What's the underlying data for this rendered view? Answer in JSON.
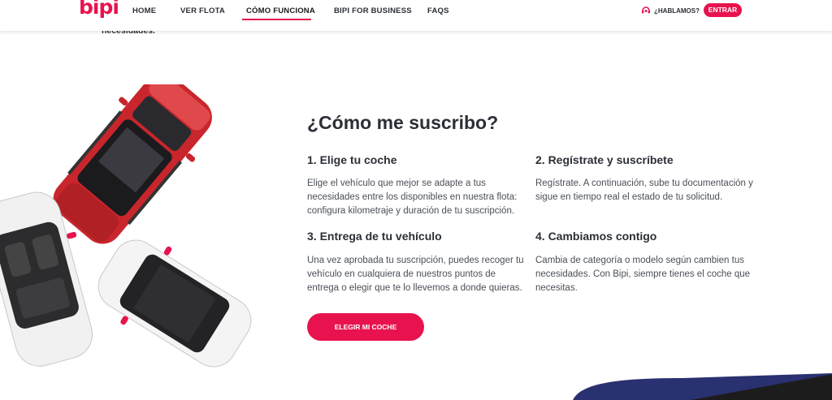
{
  "header": {
    "logo": "bipi",
    "nav": [
      {
        "label": "HOME"
      },
      {
        "label": "VER FLOTA"
      },
      {
        "label": "CÓMO FUNCIONA",
        "active": true
      },
      {
        "label": "BIPI FOR BUSINESS"
      },
      {
        "label": "FAQS"
      }
    ],
    "help_label": "¿HABLAMOS?",
    "login_label": "ENTRAR"
  },
  "previous_section_text": "necesidades.",
  "main": {
    "title": "¿Cómo me suscribo?",
    "steps": [
      {
        "title": "1. Elige tu coche",
        "text": "Elige el vehículo que mejor se adapte a tus necesidades entre los disponibles en nuestra flota: configura kilometraje y duración de tu suscripción."
      },
      {
        "title": "2. Regístrate y suscríbete",
        "text": "Regístrate. A continuación, sube tu documentación y sigue en tiempo real el estado de tu solicitud."
      },
      {
        "title": "3. Entrega de tu vehículo",
        "text": "Una vez aprobada tu suscripción, puedes recoger tu vehículo en cualquiera de nuestros puntos de entrega o elegir que te lo llevemos a donde quieras."
      },
      {
        "title": "4. Cambiamos contigo",
        "text": "Cambia de categoría o modelo según cambien tus necesidades. Con Bipi, siempre tienes el coche que necesitas."
      }
    ],
    "cta_label": "ELEGIR MI COCHE"
  },
  "colors": {
    "brand": "#e8134e",
    "text": "#2b2f36",
    "navy": "#2a3170"
  }
}
